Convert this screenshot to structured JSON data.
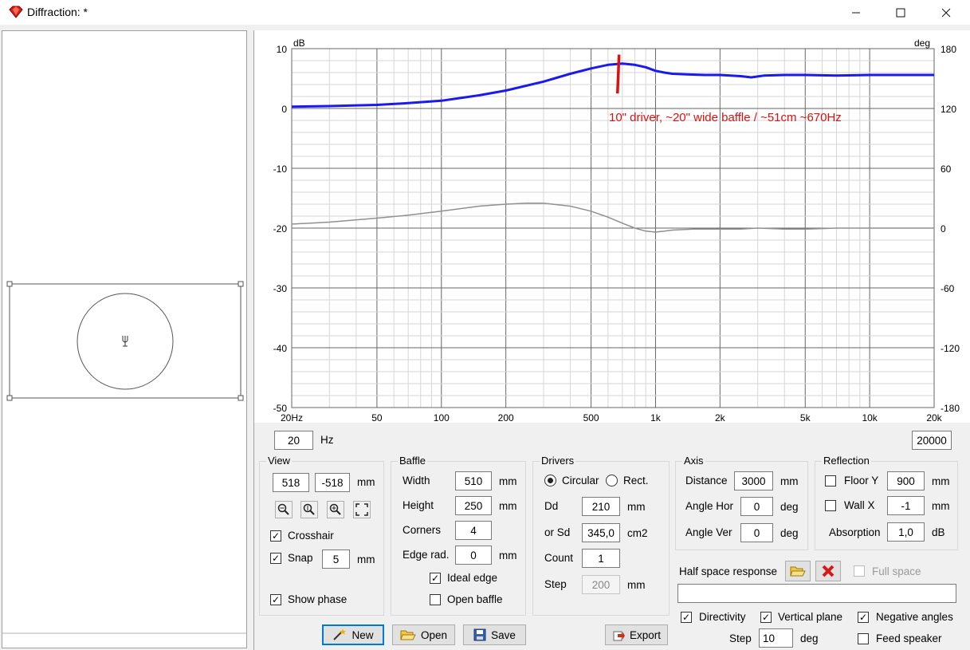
{
  "window": {
    "title": "Diffraction: *"
  },
  "chart_data": {
    "type": "line",
    "title": "",
    "xlabel": "",
    "ylabel": "dB",
    "y2label": "deg",
    "x_scale": "log",
    "xlim": [
      20,
      20000
    ],
    "ylim": [
      -50,
      10
    ],
    "y2lim": [
      -180,
      180
    ],
    "x_tick_labels": [
      "20Hz",
      "50",
      "100",
      "200",
      "500",
      "1k",
      "2k",
      "5k",
      "10k",
      "20k"
    ],
    "x_tick_values": [
      20,
      50,
      100,
      200,
      500,
      1000,
      2000,
      5000,
      10000,
      20000
    ],
    "y_ticks": [
      10,
      0,
      -10,
      -20,
      -30,
      -40,
      -50
    ],
    "y2_ticks": [
      180,
      120,
      60,
      0,
      -60,
      -120,
      -180
    ],
    "grid": true,
    "annotation": "10\" driver, ~20\" wide baffle / ~51cm ~670Hz",
    "marker_freq": 670,
    "series": [
      {
        "axis": "left",
        "color": "#1a1aee",
        "x": [
          20,
          30,
          50,
          70,
          100,
          150,
          200,
          300,
          400,
          500,
          600,
          700,
          800,
          900,
          1000,
          1100,
          1200,
          1400,
          1700,
          2000,
          2500,
          2800,
          3200,
          4000,
          5000,
          7000,
          10000,
          15000,
          20000
        ],
        "y": [
          0.3,
          0.4,
          0.6,
          0.9,
          1.3,
          2.2,
          3.0,
          4.5,
          5.8,
          6.7,
          7.3,
          7.5,
          7.3,
          6.9,
          6.3,
          6.0,
          5.8,
          5.7,
          5.6,
          5.6,
          5.4,
          5.2,
          5.5,
          5.6,
          5.6,
          5.5,
          5.6,
          5.6,
          5.6
        ]
      },
      {
        "axis": "right",
        "color": "#909090",
        "x": [
          20,
          30,
          50,
          70,
          100,
          150,
          200,
          250,
          300,
          400,
          500,
          600,
          700,
          800,
          900,
          1000,
          1100,
          1200,
          1500,
          2000,
          2500,
          3000,
          4000,
          5000,
          7000,
          10000,
          15000,
          20000
        ],
        "y": [
          4,
          6,
          10,
          13,
          17,
          22,
          24,
          25,
          25,
          22,
          17,
          11,
          5,
          0,
          -3,
          -4,
          -3,
          -2,
          -1,
          -1,
          -1,
          0,
          -1,
          -1,
          0,
          0,
          0,
          0
        ]
      }
    ]
  },
  "range": {
    "min": "20",
    "max": "20000",
    "unit": "Hz"
  },
  "view": {
    "title": "View",
    "x": "518",
    "y": "-518",
    "unit": "mm",
    "crosshair_label": "Crosshair",
    "snap_label": "Snap",
    "snap_value": "5",
    "snap_unit": "mm",
    "show_phase_label": "Show phase"
  },
  "baffle": {
    "title": "Baffle",
    "width_label": "Width",
    "width": "510",
    "height_label": "Height",
    "height": "250",
    "corners_label": "Corners",
    "corners": "4",
    "edge_label": "Edge rad.",
    "edge": "0",
    "unit": "mm",
    "ideal_edge": "Ideal edge",
    "open_baffle": "Open baffle"
  },
  "drivers": {
    "title": "Drivers",
    "circular": "Circular",
    "rect": "Rect.",
    "dd_label": "Dd",
    "dd": "210",
    "dd_unit": "mm",
    "sd_label": "or Sd",
    "sd": "345,0",
    "sd_unit": "cm2",
    "count_label": "Count",
    "count": "1",
    "step_label": "Step",
    "step": "200",
    "step_unit": "mm"
  },
  "axis": {
    "title": "Axis",
    "distance_label": "Distance",
    "distance": "3000",
    "distance_unit": "mm",
    "hor_label": "Angle Hor",
    "hor": "0",
    "ver_label": "Angle Ver",
    "ver": "0",
    "deg": "deg"
  },
  "reflection": {
    "title": "Reflection",
    "floor_label": "Floor Y",
    "floor": "900",
    "wall_label": "Wall  X",
    "wall": "-1",
    "unit": "mm",
    "absorption_label": "Absorption",
    "absorption": "1,0",
    "absorption_unit": "dB"
  },
  "half_space": {
    "label": "Half space response",
    "full_space": "Full space",
    "path": ""
  },
  "directivity": {
    "label": "Directivity",
    "vertical": "Vertical plane",
    "negative": "Negative angles",
    "step_label": "Step",
    "step": "10",
    "step_unit": "deg",
    "feed": "Feed speaker"
  },
  "buttons": {
    "new": "New",
    "open": "Open",
    "save": "Save",
    "export": "Export"
  }
}
